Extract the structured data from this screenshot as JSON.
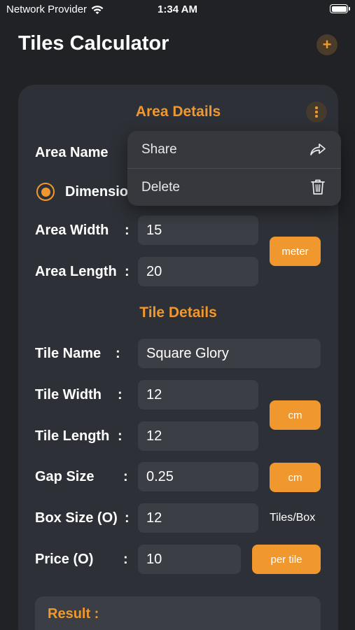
{
  "status_bar": {
    "carrier": "Network Provider",
    "time": "1:34 AM"
  },
  "header": {
    "title": "Tiles Calculator",
    "add_label": "+"
  },
  "area_details": {
    "title": "Area Details",
    "area_name_label": "Area Name",
    "colon": ":",
    "dimension_label": "Dimensio",
    "area_width_label": "Area Width",
    "area_width_value": "15",
    "area_length_label": "Area Length",
    "area_length_value": "20",
    "unit": "meter"
  },
  "menu": {
    "share_label": "Share",
    "delete_label": "Delete"
  },
  "tile_details": {
    "title": "Tile Details",
    "tile_name_label": "Tile Name",
    "tile_name_value": "Square Glory",
    "tile_width_label": "Tile Width",
    "tile_width_value": "12",
    "tile_length_label": "Tile Length",
    "tile_length_value": "12",
    "tile_unit": "cm",
    "gap_size_label": "Gap Size",
    "gap_size_value": "0.25",
    "gap_unit": "cm",
    "box_size_label": "Box Size (O)",
    "box_size_value": "12",
    "box_unit": "Tiles/Box",
    "price_label": "Price (O)",
    "price_value": "10",
    "price_unit": "per tile"
  },
  "result": {
    "label": "Result :"
  },
  "colors": {
    "accent": "#f0982e",
    "background": "#202226",
    "card": "#2d3036",
    "field": "#3b3e45"
  },
  "icons": {
    "wifi": "wifi-icon",
    "battery": "battery-icon",
    "add": "plus-icon",
    "more": "more-vertical-icon",
    "share": "share-icon",
    "delete": "trash-icon"
  }
}
